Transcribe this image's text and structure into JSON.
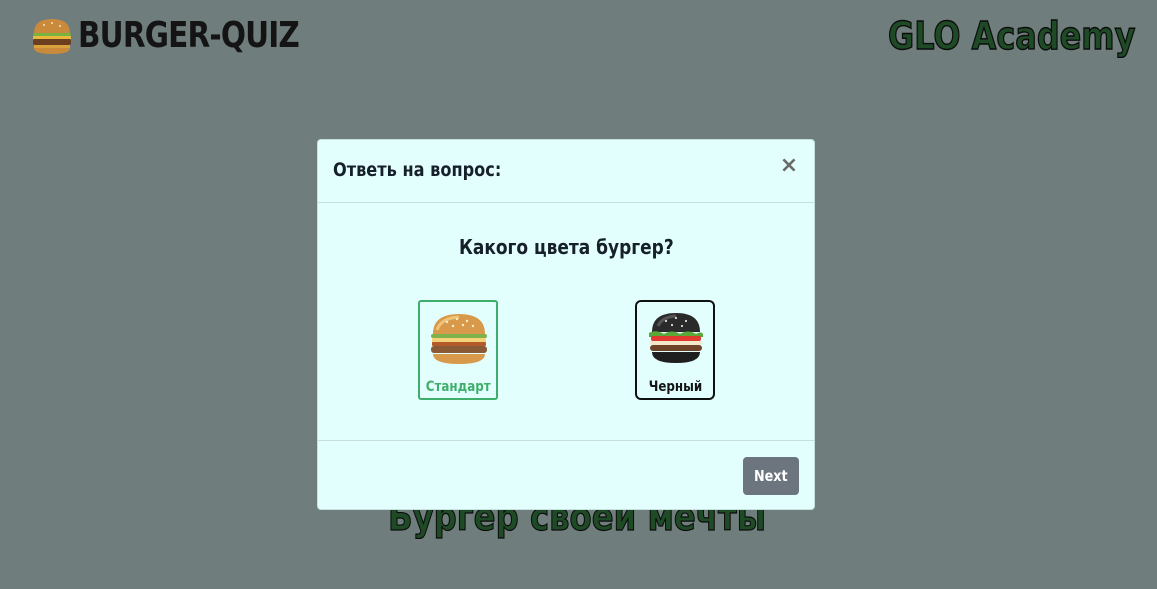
{
  "header": {
    "logo_text": "BURGER-QUIZ",
    "brand": "GLO Academy"
  },
  "background": {
    "tagline": "Бургер своей мечты"
  },
  "modal": {
    "title": "Ответь на вопрос:",
    "close_label": "×",
    "question": "Какого цвета бургер?",
    "answers": [
      {
        "label": "Стандарт",
        "icon": "burger-standard-image",
        "selected": true
      },
      {
        "label": "Черный",
        "icon": "burger-black-image",
        "selected": false
      }
    ],
    "next_label": "Next"
  },
  "colors": {
    "page_bg": "#6f7d7c",
    "modal_bg": "#e2fffe",
    "selected_border": "#3fae6a",
    "next_button": "#6c757d",
    "brand_green": "#1f4a26"
  }
}
